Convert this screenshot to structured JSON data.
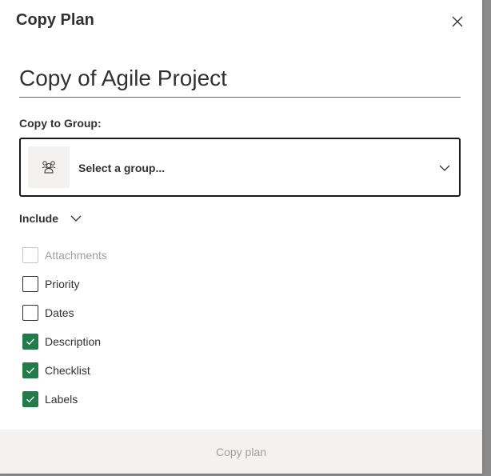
{
  "dialog": {
    "title": "Copy Plan",
    "close_icon": "close-icon"
  },
  "plan_name": {
    "value": "Copy of Agile Project"
  },
  "group": {
    "label": "Copy to Group:",
    "placeholder": "Select a group...",
    "icon": "group-icon",
    "chevron_icon": "chevron-down-icon"
  },
  "include": {
    "label": "Include",
    "chevron_icon": "chevron-down-icon",
    "options": [
      {
        "label": "Attachments",
        "checked": false,
        "disabled": true
      },
      {
        "label": "Priority",
        "checked": false,
        "disabled": false
      },
      {
        "label": "Dates",
        "checked": false,
        "disabled": false
      },
      {
        "label": "Description",
        "checked": true,
        "disabled": false
      },
      {
        "label": "Checklist",
        "checked": true,
        "disabled": false
      },
      {
        "label": "Labels",
        "checked": true,
        "disabled": false
      }
    ]
  },
  "footer": {
    "copy_label": "Copy plan"
  },
  "colors": {
    "accent": "#237b4b",
    "underline": "#2e7d4f",
    "disabled_text": "#a19f9d",
    "footer_bg": "#f3f2f1"
  }
}
